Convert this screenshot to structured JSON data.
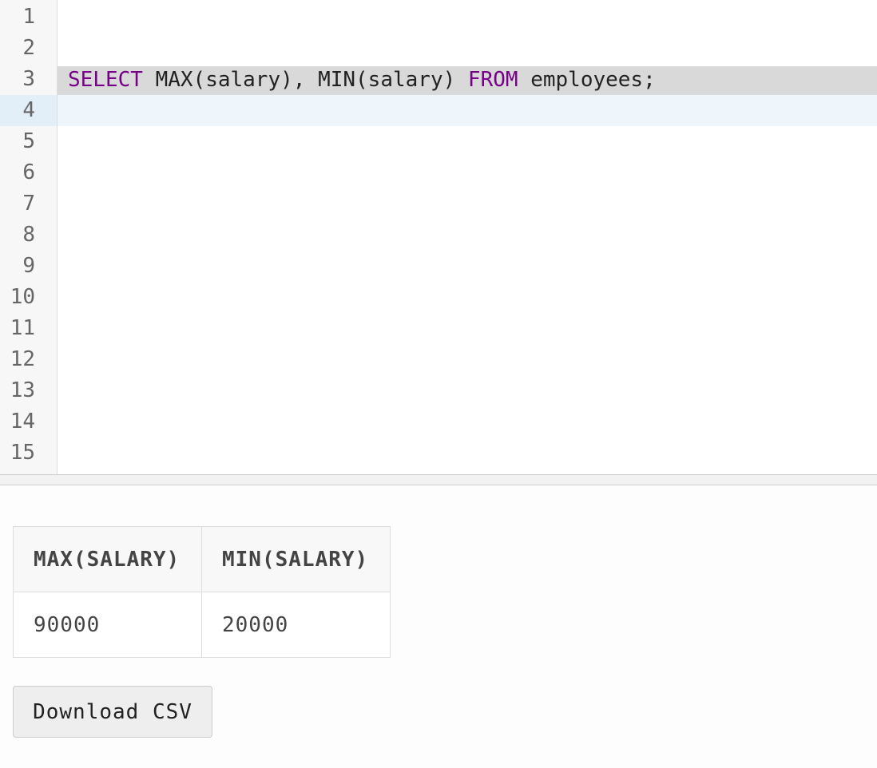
{
  "editor": {
    "line_numbers": [
      "1",
      "2",
      "3",
      "4",
      "5",
      "6",
      "7",
      "8",
      "9",
      "10",
      "11",
      "12",
      "13",
      "14",
      "15"
    ],
    "active_line": 4,
    "selected_line": 3,
    "code": {
      "line3": {
        "kw_select": "SELECT",
        "segment1": " MAX(salary), MIN(salary) ",
        "kw_from": "FROM",
        "segment2": " employees;"
      }
    },
    "keyword_color": "#770088"
  },
  "results": {
    "columns": [
      "MAX(SALARY)",
      "MIN(SALARY)"
    ],
    "rows": [
      [
        "90000",
        "20000"
      ]
    ]
  },
  "actions": {
    "download_label": "Download CSV"
  }
}
